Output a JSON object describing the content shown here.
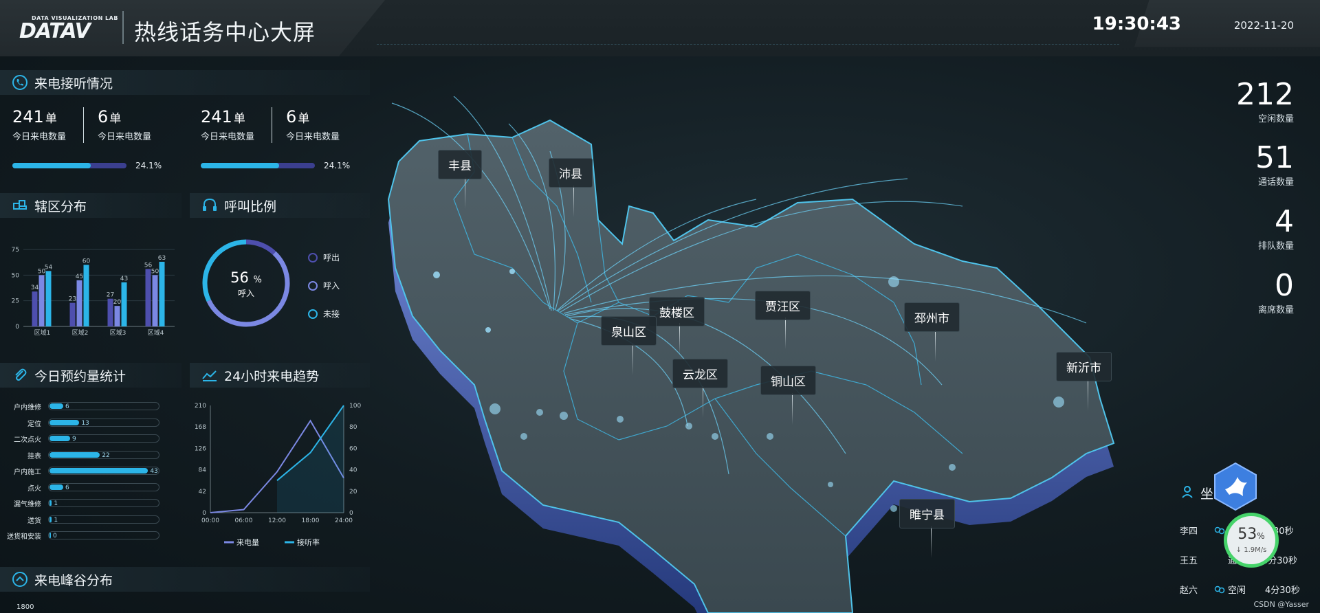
{
  "header": {
    "logo_small": "DATA VISUALIZATION LAB",
    "logo_big": "DATAV",
    "title": "热线话务中心大屏",
    "time": "19:30:43",
    "date": "2022-11-20"
  },
  "calls": {
    "title": "来电接听情况",
    "groups": [
      {
        "items": [
          {
            "value": "241",
            "unit": "单",
            "label": "今日来电数量"
          },
          {
            "value": "6",
            "unit": "单",
            "label": "今日来电数量"
          }
        ],
        "progress": 0.241,
        "progress_text": "24.1%"
      },
      {
        "items": [
          {
            "value": "241",
            "unit": "单",
            "label": "今日来电数量"
          },
          {
            "value": "6",
            "unit": "单",
            "label": "今日来电数量"
          }
        ],
        "progress": 0.241,
        "progress_text": "24.1%"
      }
    ]
  },
  "district": {
    "title": "辖区分布",
    "chart_data": {
      "type": "bar",
      "categories": [
        "区域1",
        "区域2",
        "区域3",
        "区域4"
      ],
      "series": [
        {
          "values": [
            34,
            23,
            27,
            56
          ],
          "color": "#4e4fae"
        },
        {
          "values": [
            50,
            45,
            20,
            50
          ],
          "color": "#7b88e3"
        },
        {
          "values": [
            54,
            60,
            43,
            63
          ],
          "color": "#2cb5e8"
        }
      ],
      "ylim": [
        0,
        75
      ],
      "yticks": [
        0,
        25,
        50,
        75
      ]
    }
  },
  "call_ratio": {
    "title": "呼叫比例",
    "center_value": "56",
    "center_unit": "%",
    "center_label": "呼入",
    "chart_data": {
      "type": "pie",
      "slices": [
        {
          "name": "呼出",
          "value": 12,
          "color": "#4e4fae"
        },
        {
          "name": "呼入",
          "value": 56,
          "color": "#7b88e3"
        },
        {
          "name": "未接",
          "value": 32,
          "color": "#2cb5e8"
        }
      ]
    },
    "legend": [
      {
        "label": "呼出",
        "color": "#4e4fae"
      },
      {
        "label": "呼入",
        "color": "#7b88e3"
      },
      {
        "label": "未接",
        "color": "#2cb5e8"
      }
    ]
  },
  "appointments": {
    "title": "今日预约量统计",
    "chart_data": {
      "type": "bar",
      "orientation": "horizontal",
      "categories": [
        "户内维修",
        "定位",
        "二次点火",
        "挂表",
        "户内施工",
        "点火",
        "漏气维修",
        "送货",
        "送货和安装"
      ],
      "values": [
        6,
        13,
        9,
        22,
        43,
        6,
        1,
        1,
        0
      ],
      "xlim": [
        0,
        45
      ]
    }
  },
  "trend": {
    "title": "24小时来电趋势",
    "chart_data": {
      "type": "line",
      "x": [
        "00:00",
        "06:00",
        "12:00",
        "18:00",
        "24:00"
      ],
      "series": [
        {
          "name": "来电量",
          "axis": "left",
          "color": "#7b88e3",
          "points": [
            [
              0,
              0
            ],
            [
              6,
              6
            ],
            [
              12,
              80
            ],
            [
              18,
              180
            ],
            [
              24,
              68
            ]
          ]
        },
        {
          "name": "接听率",
          "axis": "right",
          "color": "#2cb5e8",
          "points": [
            [
              12,
              30
            ],
            [
              18,
              56
            ],
            [
              24,
              100
            ]
          ]
        }
      ],
      "y_left": {
        "ticks": [
          0,
          42,
          84,
          126,
          168,
          210
        ],
        "lim": [
          0,
          210
        ]
      },
      "y_right": {
        "ticks": [
          0,
          20,
          40,
          60,
          80,
          100
        ],
        "lim": [
          0,
          100
        ]
      }
    }
  },
  "peak": {
    "title": "来电峰谷分布",
    "ytick_top": "1800"
  },
  "map": {
    "regions": [
      "丰县",
      "沛县",
      "鼓楼区",
      "贾汪区",
      "泉山区",
      "邳州市",
      "新沂市",
      "云龙区",
      "铜山区",
      "睢宁县"
    ]
  },
  "right_stats": [
    {
      "value": "212",
      "label": "空闲数量"
    },
    {
      "value": "51",
      "label": "通话数量"
    },
    {
      "value": "4",
      "label": "排队数量"
    },
    {
      "value": "0",
      "label": "离席数量"
    }
  ],
  "agents": {
    "title": "坐",
    "rows": [
      {
        "name": "李四",
        "status": "",
        "duration": "30秒"
      },
      {
        "name": "王五",
        "status": "通",
        "duration": "3分30秒"
      },
      {
        "name": "赵六",
        "status": "空闲",
        "duration": "4分30秒"
      }
    ]
  },
  "speed_ball": {
    "percent": "53",
    "rate": "↓ 1.9M/s"
  },
  "watermark": "CSDN @Yasser"
}
